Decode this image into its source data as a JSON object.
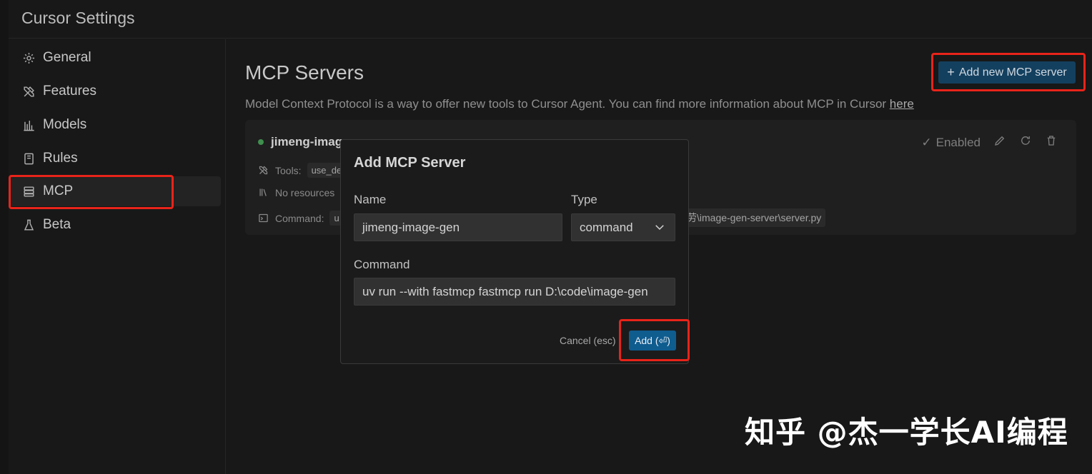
{
  "window": {
    "title": "Cursor Settings"
  },
  "sidebar": {
    "items": [
      {
        "label": "General",
        "icon": "gear-icon"
      },
      {
        "label": "Features",
        "icon": "tools-icon"
      },
      {
        "label": "Models",
        "icon": "bar-chart-icon"
      },
      {
        "label": "Rules",
        "icon": "book-icon"
      },
      {
        "label": "MCP",
        "icon": "server-icon",
        "active": true
      },
      {
        "label": "Beta",
        "icon": "flask-icon"
      }
    ]
  },
  "main": {
    "title": "MCP Servers",
    "description": "Model Context Protocol is a way to offer new tools to Cursor Agent. You can find more information about MCP in Cursor ",
    "description_link": "here",
    "add_button": "Add new MCP server",
    "server": {
      "name": "jimeng-imag",
      "status": "Enabled",
      "tools_label": "Tools:",
      "tools_value": "use_de",
      "resources_text": "No resources",
      "command_label": "Command:",
      "command_head": "u",
      "command_tail": "劳\\image-gen-server\\server.py"
    }
  },
  "dialog": {
    "title": "Add MCP Server",
    "name_label": "Name",
    "name_value": "jimeng-image-gen",
    "type_label": "Type",
    "type_value": "command",
    "command_label": "Command",
    "command_value": "uv run --with fastmcp fastmcp run D:\\code\\image-gen",
    "cancel_label": "Cancel (esc)",
    "add_label": "Add (⏎)"
  },
  "watermark": "知乎 @杰一学长AI编程",
  "colors": {
    "accent": "#14405f",
    "primary_button": "#0f5c8f",
    "highlight": "#e8241a",
    "status_dot": "#3f8f4f"
  }
}
